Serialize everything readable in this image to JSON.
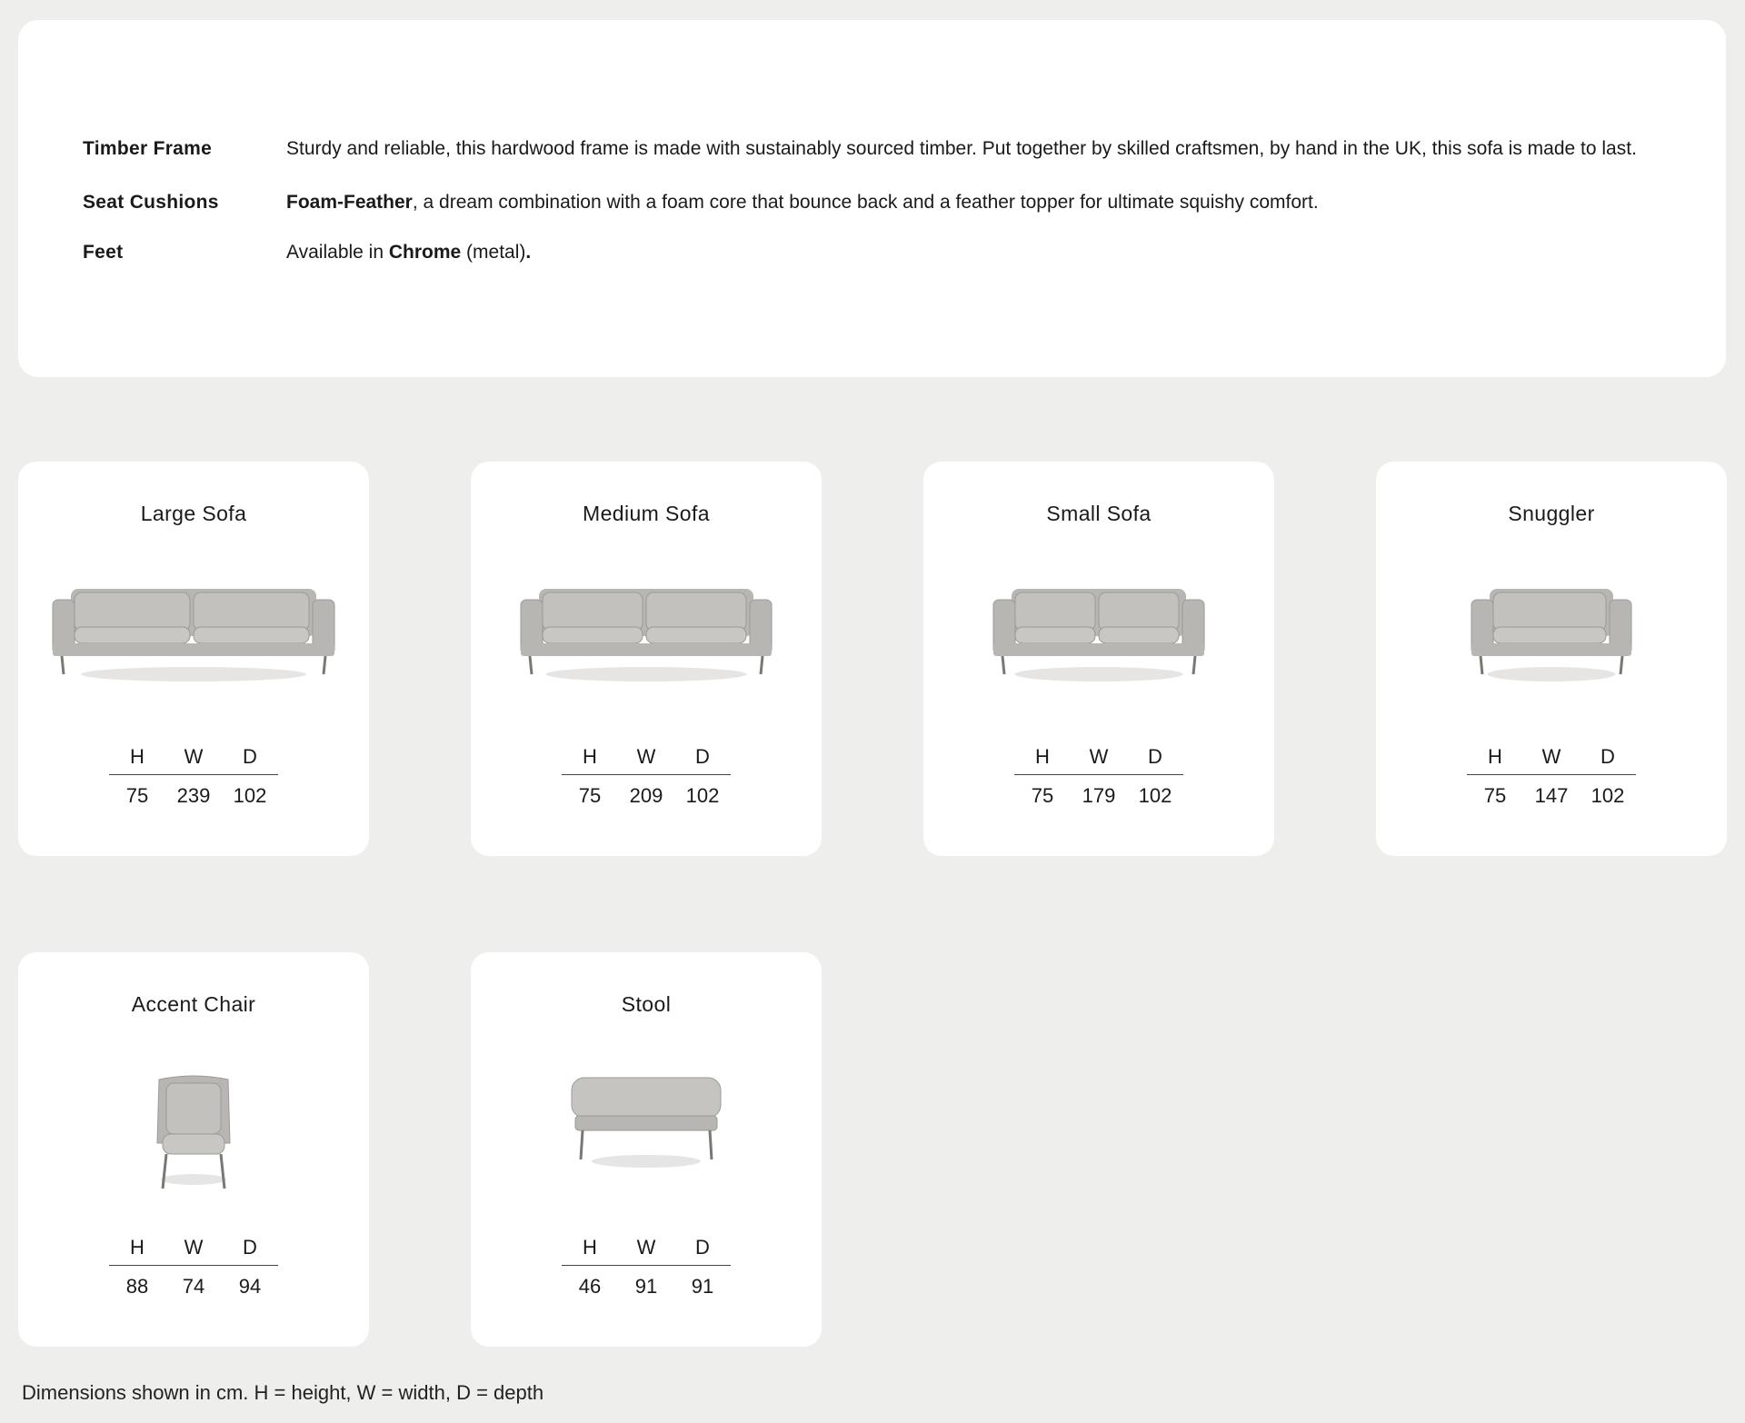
{
  "specs": [
    {
      "label": "Timber Frame",
      "parts": [
        {
          "text": "Sturdy and reliable, this hardwood frame is made with sustainably sourced timber. Put together by skilled craftsmen, by hand in the UK, this sofa is made to last.",
          "bold": false
        }
      ]
    },
    {
      "label": "Seat Cushions",
      "parts": [
        {
          "text": "Foam-Feather",
          "bold": true
        },
        {
          "text": ", a dream combination with a foam core that bounce back and a feather topper for ultimate squishy comfort.",
          "bold": false
        }
      ]
    },
    {
      "label": "Feet",
      "parts": [
        {
          "text": "Available in ",
          "bold": false
        },
        {
          "text": "Chrome",
          "bold": true
        },
        {
          "text": " (metal)",
          "bold": false
        },
        {
          "text": ".",
          "bold": true
        }
      ]
    }
  ],
  "dimension_headers": [
    "H",
    "W",
    "D"
  ],
  "products": [
    {
      "name": "Large Sofa",
      "type": "sofa3",
      "dims": [
        "75",
        "239",
        "102"
      ]
    },
    {
      "name": "Medium Sofa",
      "type": "sofa3m",
      "dims": [
        "75",
        "209",
        "102"
      ]
    },
    {
      "name": "Small Sofa",
      "type": "sofa2",
      "dims": [
        "75",
        "179",
        "102"
      ]
    },
    {
      "name": "Snuggler",
      "type": "snuggler",
      "dims": [
        "75",
        "147",
        "102"
      ]
    },
    {
      "name": "Accent Chair",
      "type": "chair",
      "dims": [
        "88",
        "74",
        "94"
      ]
    },
    {
      "name": "Stool",
      "type": "stool",
      "dims": [
        "46",
        "91",
        "91"
      ]
    }
  ],
  "footnote": "Dimensions shown in cm. H = height, W = width, D = depth",
  "colors": {
    "background": "#eeeeec",
    "card": "#ffffff",
    "fabric": "#b8b6b2",
    "fabric_dark": "#9c9a96",
    "legs": "#7a7874"
  }
}
